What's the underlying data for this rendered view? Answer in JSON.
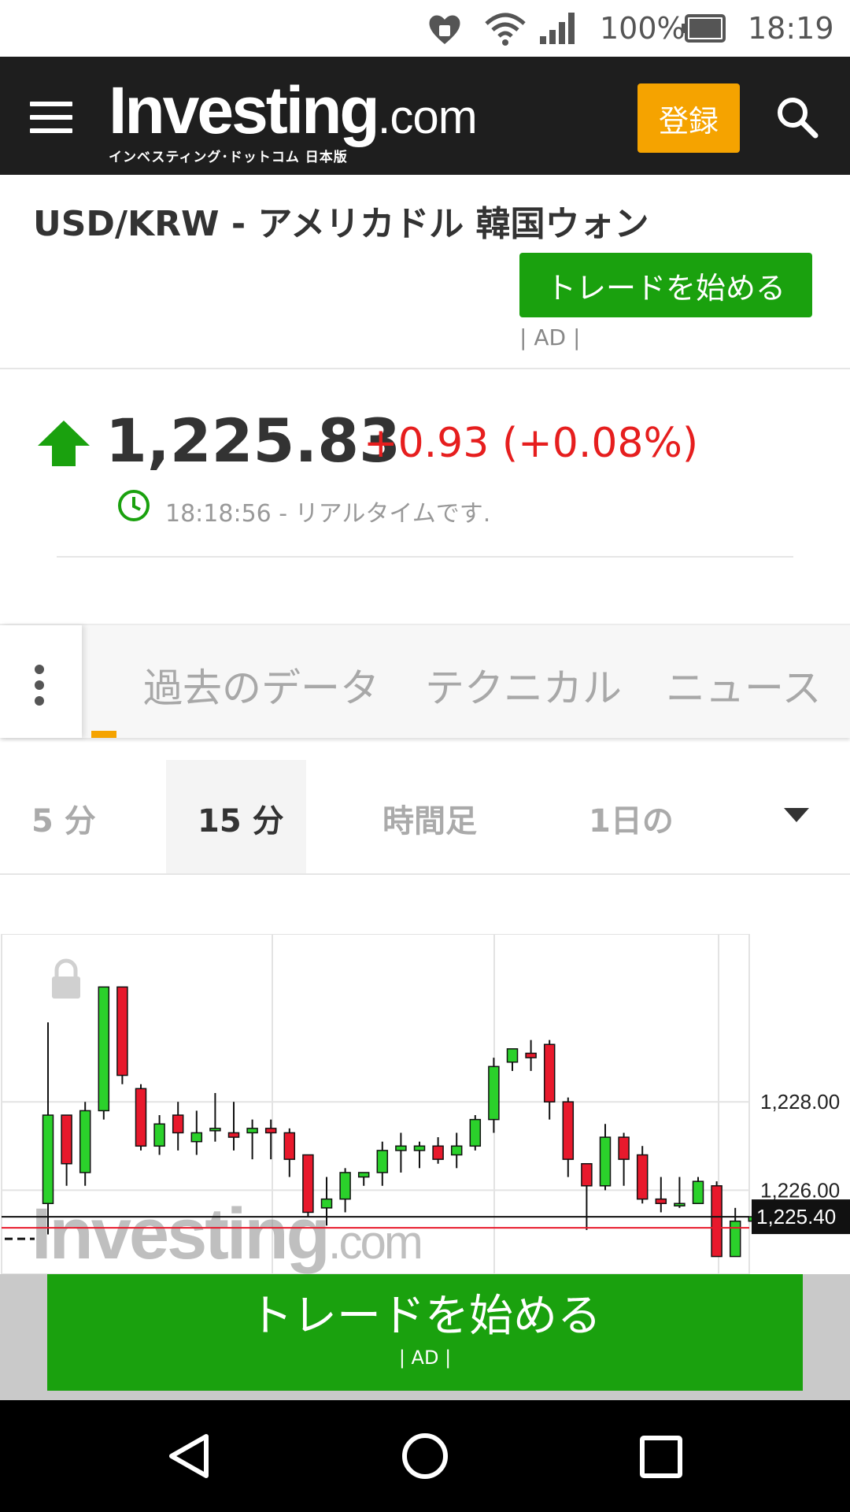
{
  "status_bar": {
    "battery": "100%",
    "time": "18:19"
  },
  "header": {
    "logo_text": "Investing",
    "logo_suffix": ".com",
    "logo_sub": "インベスティング･ドットコム 日本版",
    "register_label": "登録"
  },
  "instrument": {
    "title": "USD/KRW - アメリカドル 韓国ウォン",
    "trade_button": "トレードを始める",
    "ad_label": "| AD |"
  },
  "quote": {
    "price": "1,225.83",
    "change": "+0.93 (+0.08%)",
    "timestamp": "18:18:56 - リアルタイムです."
  },
  "tabs": [
    "過去のデータ",
    "テクニカル",
    "ニュース"
  ],
  "timeframes": {
    "options": [
      "5 分",
      "15 分",
      "時間足",
      "1日の"
    ],
    "selected": "15 分"
  },
  "chart_data": {
    "type": "candlestick",
    "y_labels": [
      "1,228.00",
      "1,226.00"
    ],
    "current_price_label": "1,225.40",
    "ylim": [
      1224.1,
      1231.8
    ],
    "candles": [
      {
        "o": 1225.7,
        "h": 1229.8,
        "l": 1225.0,
        "c": 1227.7
      },
      {
        "o": 1227.7,
        "h": 1227.7,
        "l": 1226.1,
        "c": 1226.6
      },
      {
        "o": 1226.4,
        "h": 1228.0,
        "l": 1226.1,
        "c": 1227.8
      },
      {
        "o": 1227.8,
        "h": 1230.6,
        "l": 1227.6,
        "c": 1230.6
      },
      {
        "o": 1230.6,
        "h": 1230.6,
        "l": 1228.4,
        "c": 1228.6
      },
      {
        "o": 1228.3,
        "h": 1228.4,
        "l": 1226.9,
        "c": 1227.0
      },
      {
        "o": 1227.0,
        "h": 1227.7,
        "l": 1226.8,
        "c": 1227.5
      },
      {
        "o": 1227.7,
        "h": 1228.0,
        "l": 1226.9,
        "c": 1227.3
      },
      {
        "o": 1227.1,
        "h": 1227.8,
        "l": 1226.8,
        "c": 1227.3
      },
      {
        "o": 1227.4,
        "h": 1228.2,
        "l": 1227.1,
        "c": 1227.4
      },
      {
        "o": 1227.3,
        "h": 1228.0,
        "l": 1226.9,
        "c": 1227.2
      },
      {
        "o": 1227.3,
        "h": 1227.6,
        "l": 1226.7,
        "c": 1227.4
      },
      {
        "o": 1227.4,
        "h": 1227.6,
        "l": 1226.7,
        "c": 1227.3
      },
      {
        "o": 1227.3,
        "h": 1227.4,
        "l": 1226.3,
        "c": 1226.7
      },
      {
        "o": 1226.8,
        "h": 1226.8,
        "l": 1225.4,
        "c": 1225.5
      },
      {
        "o": 1225.6,
        "h": 1226.3,
        "l": 1225.2,
        "c": 1225.8
      },
      {
        "o": 1225.8,
        "h": 1226.5,
        "l": 1225.5,
        "c": 1226.4
      },
      {
        "o": 1226.3,
        "h": 1226.4,
        "l": 1226.1,
        "c": 1226.4
      },
      {
        "o": 1226.4,
        "h": 1227.1,
        "l": 1226.1,
        "c": 1226.9
      },
      {
        "o": 1226.9,
        "h": 1227.3,
        "l": 1226.4,
        "c": 1227.0
      },
      {
        "o": 1226.9,
        "h": 1227.1,
        "l": 1226.5,
        "c": 1227.0
      },
      {
        "o": 1227.0,
        "h": 1227.2,
        "l": 1226.6,
        "c": 1226.7
      },
      {
        "o": 1226.8,
        "h": 1227.3,
        "l": 1226.5,
        "c": 1227.0
      },
      {
        "o": 1227.0,
        "h": 1227.7,
        "l": 1226.9,
        "c": 1227.6
      },
      {
        "o": 1227.6,
        "h": 1229.0,
        "l": 1227.3,
        "c": 1228.8
      },
      {
        "o": 1228.9,
        "h": 1229.0,
        "l": 1228.7,
        "c": 1229.2
      },
      {
        "o": 1229.1,
        "h": 1229.4,
        "l": 1228.7,
        "c": 1229.0
      },
      {
        "o": 1229.3,
        "h": 1229.4,
        "l": 1227.6,
        "c": 1228.0
      },
      {
        "o": 1228.0,
        "h": 1228.1,
        "l": 1226.3,
        "c": 1226.7
      },
      {
        "o": 1226.6,
        "h": 1226.6,
        "l": 1225.1,
        "c": 1226.1
      },
      {
        "o": 1226.1,
        "h": 1227.5,
        "l": 1226.0,
        "c": 1227.2
      },
      {
        "o": 1227.2,
        "h": 1227.3,
        "l": 1226.1,
        "c": 1226.7
      },
      {
        "o": 1226.8,
        "h": 1227.0,
        "l": 1225.7,
        "c": 1225.8
      },
      {
        "o": 1225.8,
        "h": 1226.3,
        "l": 1225.5,
        "c": 1225.7
      },
      {
        "o": 1225.7,
        "h": 1226.3,
        "l": 1225.6,
        "c": 1225.7
      },
      {
        "o": 1225.7,
        "h": 1226.3,
        "l": 1225.7,
        "c": 1226.2
      },
      {
        "o": 1226.1,
        "h": 1226.2,
        "l": 1224.5,
        "c": 1224.5
      },
      {
        "o": 1224.5,
        "h": 1225.6,
        "l": 1224.5,
        "c": 1225.3
      },
      {
        "o": 1225.3,
        "h": 1225.7,
        "l": 1225.2,
        "c": 1225.4
      }
    ]
  },
  "footer_ad": {
    "label": "トレードを始める",
    "ad": "| AD |"
  },
  "colors": {
    "up": "#2bd12b",
    "down": "#e8192c",
    "accent": "#f5a300",
    "green_button": "#1aa10e",
    "header_bg": "#1e1e1e"
  }
}
